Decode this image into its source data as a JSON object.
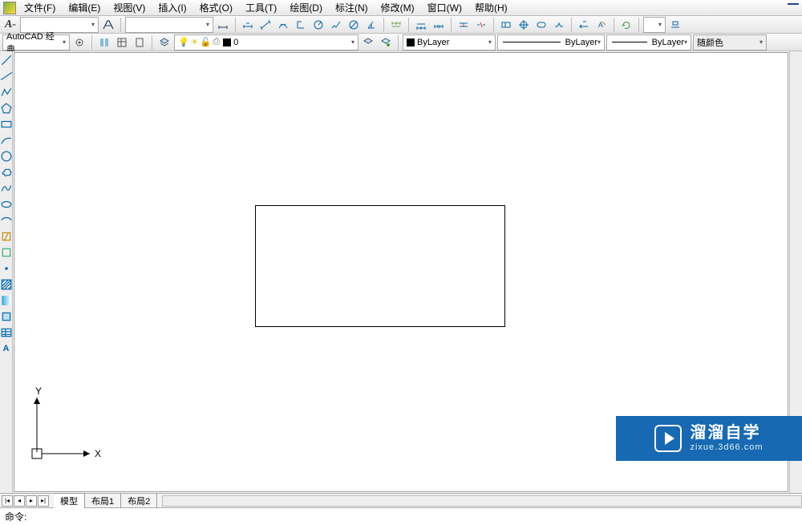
{
  "menu": {
    "items": [
      "文件(F)",
      "编辑(E)",
      "视图(V)",
      "插入(I)",
      "格式(O)",
      "工具(T)",
      "绘图(D)",
      "标注(N)",
      "修改(M)",
      "窗口(W)",
      "帮助(H)"
    ]
  },
  "toolbar1": {
    "annotate_glyph": "A-"
  },
  "toolbar2": {
    "workspace": "AutoCAD 经典",
    "layer_label": "0",
    "color_label": "ByLayer",
    "linetype_label": "ByLayer",
    "lineweight_label": "ByLayer",
    "plotstyle_label": "随颜色"
  },
  "left_tools": [
    "line",
    "cline",
    "pline",
    "polygon",
    "rect",
    "arc",
    "circle",
    "rev",
    "spline",
    "ellipse",
    "ellarc",
    "ins",
    "block",
    "pt",
    "hatch",
    "grad",
    "region",
    "table",
    "text"
  ],
  "icons": {
    "dim_linear": "linear-dim-icon",
    "dim_aligned": "aligned-dim-icon",
    "dim_arc": "arc-dim-icon",
    "dim_ord": "ordinate-dim-icon",
    "dim_rad": "radius-dim-icon",
    "dim_dia": "diameter-dim-icon",
    "dim_ang": "angular-dim-icon",
    "dim_quick": "quick-dim-icon",
    "dim_base": "baseline-dim-icon",
    "dim_cont": "continue-dim-icon",
    "dim_space": "dimspace-icon",
    "dim_break": "dimbreak-icon",
    "tolerance": "tolerance-icon",
    "center": "centermark-icon",
    "inspect": "inspect-icon",
    "jog": "jogged-icon",
    "edit": "dimedit-icon",
    "textedit": "dimtextedit-icon",
    "update": "update-icon"
  },
  "tabs": {
    "model": "模型",
    "layout1": "布局1",
    "layout2": "布局2"
  },
  "cmd": {
    "prompt": "命令:"
  },
  "ucs": {
    "x": "X",
    "y": "Y"
  },
  "watermark": {
    "title": "溜溜自学",
    "sub": "zixue.3d66.com"
  }
}
